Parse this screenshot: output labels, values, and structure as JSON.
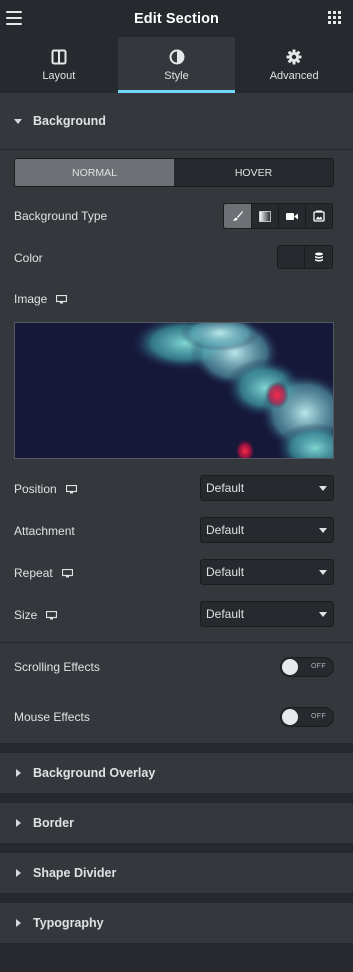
{
  "header": {
    "title": "Edit Section",
    "menu_icon": "hamburger-icon",
    "apps_icon": "grid-icon"
  },
  "tabs": [
    {
      "label": "Layout",
      "icon": "layout-columns-icon",
      "active": false
    },
    {
      "label": "Style",
      "icon": "half-circle-icon",
      "active": true
    },
    {
      "label": "Advanced",
      "icon": "gear-icon",
      "active": false
    }
  ],
  "background": {
    "title": "Background",
    "state_tabs": {
      "normal": "NORMAL",
      "hover": "HOVER",
      "active": "NORMAL"
    },
    "type_label": "Background Type",
    "type_buttons": [
      "brush-icon",
      "gradient-icon",
      "video-icon",
      "slideshow-icon"
    ],
    "color_label": "Color",
    "image_label": "Image",
    "position": {
      "label": "Position",
      "value": "Default"
    },
    "attachment": {
      "label": "Attachment",
      "value": "Default"
    },
    "repeat": {
      "label": "Repeat",
      "value": "Default"
    },
    "size": {
      "label": "Size",
      "value": "Default"
    },
    "scrolling_effects": {
      "label": "Scrolling Effects",
      "state": "OFF"
    },
    "mouse_effects": {
      "label": "Mouse Effects",
      "state": "OFF"
    }
  },
  "sections": {
    "background_overlay": "Background Overlay",
    "border": "Border",
    "shape_divider": "Shape Divider",
    "typography": "Typography"
  },
  "colors": {
    "accent": "#71d7f7",
    "panel": "#34383c",
    "dark": "#26292d"
  }
}
